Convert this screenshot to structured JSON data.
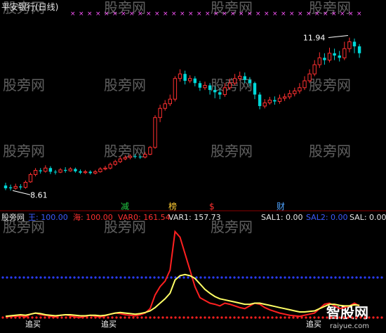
{
  "header": {
    "title": "平安银行(日线)"
  },
  "price_panel": {
    "high_label": "11.94",
    "low_label": "8.61",
    "markers": [
      {
        "text": "减",
        "color": "#22cc44"
      },
      {
        "text": "榜",
        "color": "#ffcc33"
      },
      {
        "text": "$",
        "color": "#ff3030"
      },
      {
        "text": "财",
        "color": "#4fa3ff"
      }
    ]
  },
  "indicator_panel": {
    "labels": [
      {
        "text": "王: 100.00",
        "color": "#3b5bff"
      },
      {
        "text": "海: 100.00",
        "color": "#ff3030"
      },
      {
        "text": "VAR0: 161.54",
        "color": "#ff3030"
      },
      {
        "text": "VAR1: 157.73",
        "color": "#e6e6e6"
      },
      {
        "text": "SAL1: 0.00",
        "color": "#e6e6e6"
      },
      {
        "text": "SAL2: 0.00",
        "color": "#3b5bff"
      },
      {
        "text": "SAL: 0.00",
        "color": "#e6e6e6"
      }
    ],
    "signals": [
      {
        "text": "追买"
      },
      {
        "text": "追买"
      },
      {
        "text": "追买"
      }
    ]
  },
  "watermarks": [
    "股旁网",
    "智股网",
    "raiyue.com"
  ],
  "colors": {
    "up": "#ff3030",
    "down": "#00d8d8",
    "flat": "#ffffff",
    "var0": "#ff2020",
    "var1": "#ffff66",
    "blue_dots": "#2a3dff",
    "red_dots": "#ff2020",
    "pink_marks": "#ff55ff",
    "separator": "#8b0000"
  },
  "chart_data": [
    {
      "type": "candlestick",
      "title": "平安银行(日线)",
      "annotations": [
        "11.94",
        "8.61"
      ],
      "candles": [
        [
          8.72,
          8.66,
          8.78,
          8.62
        ],
        [
          8.68,
          8.66,
          8.74,
          8.61
        ],
        [
          8.66,
          8.7,
          8.76,
          8.63
        ],
        [
          8.7,
          8.68,
          8.75,
          8.63
        ],
        [
          8.68,
          8.79,
          8.83,
          8.65
        ],
        [
          8.8,
          8.96,
          9.0,
          8.78
        ],
        [
          8.96,
          9.05,
          9.1,
          8.92
        ],
        [
          9.05,
          9.03,
          9.1,
          8.98
        ],
        [
          9.03,
          9.1,
          9.16,
          9.0
        ],
        [
          9.1,
          9.02,
          9.14,
          8.97
        ],
        [
          9.02,
          9.01,
          9.06,
          8.96
        ],
        [
          9.01,
          9.06,
          9.1,
          8.99
        ],
        [
          9.06,
          9.04,
          9.12,
          9.0
        ],
        [
          9.04,
          9.08,
          9.12,
          9.02
        ],
        [
          9.08,
          9.03,
          9.11,
          9.0
        ],
        [
          9.03,
          9.0,
          9.07,
          8.97
        ],
        [
          9.0,
          9.02,
          9.06,
          8.97
        ],
        [
          9.02,
          8.99,
          9.05,
          8.96
        ],
        [
          8.99,
          9.02,
          9.06,
          8.96
        ],
        [
          9.02,
          9.08,
          9.12,
          9.0
        ],
        [
          9.08,
          9.1,
          9.15,
          9.05
        ],
        [
          9.1,
          9.18,
          9.22,
          9.07
        ],
        [
          9.18,
          9.24,
          9.28,
          9.15
        ],
        [
          9.24,
          9.3,
          9.35,
          9.21
        ],
        [
          9.3,
          9.33,
          9.38,
          9.27
        ],
        [
          9.33,
          9.36,
          9.4,
          9.29
        ],
        [
          9.36,
          9.35,
          9.4,
          9.31
        ],
        [
          9.35,
          9.34,
          9.39,
          9.3
        ],
        [
          9.34,
          9.4,
          9.45,
          9.31
        ],
        [
          9.4,
          9.55,
          9.58,
          9.38
        ],
        [
          9.55,
          10.2,
          10.25,
          9.52
        ],
        [
          10.2,
          10.4,
          10.48,
          10.1
        ],
        [
          10.4,
          10.5,
          10.58,
          10.35
        ],
        [
          10.5,
          10.6,
          10.7,
          10.45
        ],
        [
          10.6,
          11.05,
          11.1,
          10.55
        ],
        [
          11.05,
          11.15,
          11.25,
          10.98
        ],
        [
          11.15,
          11.0,
          11.22,
          10.92
        ],
        [
          11.0,
          11.05,
          11.12,
          10.95
        ],
        [
          11.05,
          10.95,
          11.1,
          10.88
        ],
        [
          10.95,
          10.85,
          11.0,
          10.78
        ],
        [
          10.85,
          10.9,
          10.98,
          10.8
        ],
        [
          10.9,
          10.8,
          10.95,
          10.7
        ],
        [
          10.8,
          10.75,
          10.88,
          10.62
        ],
        [
          10.75,
          10.7,
          10.82,
          10.6
        ],
        [
          10.7,
          10.85,
          10.95,
          10.65
        ],
        [
          10.85,
          10.95,
          11.05,
          10.8
        ],
        [
          10.95,
          11.05,
          11.15,
          10.9
        ],
        [
          11.05,
          11.1,
          11.2,
          11.0
        ],
        [
          11.1,
          11.02,
          11.18,
          10.95
        ],
        [
          11.02,
          10.95,
          11.08,
          10.88
        ],
        [
          10.95,
          10.7,
          10.98,
          10.6
        ],
        [
          10.7,
          10.45,
          10.75,
          10.38
        ],
        [
          10.45,
          10.52,
          10.6,
          10.4
        ],
        [
          10.52,
          10.58,
          10.65,
          10.48
        ],
        [
          10.58,
          10.55,
          10.66,
          10.48
        ],
        [
          10.55,
          10.62,
          10.7,
          10.5
        ],
        [
          10.62,
          10.65,
          10.72,
          10.56
        ],
        [
          10.65,
          10.72,
          10.8,
          10.6
        ],
        [
          10.72,
          10.78,
          10.85,
          10.66
        ],
        [
          10.78,
          10.85,
          10.95,
          10.72
        ],
        [
          10.85,
          11.0,
          11.1,
          10.8
        ],
        [
          11.0,
          11.15,
          11.25,
          10.95
        ],
        [
          11.15,
          11.35,
          11.45,
          11.1
        ],
        [
          11.35,
          11.5,
          11.62,
          11.28
        ],
        [
          11.5,
          11.45,
          11.6,
          11.35
        ],
        [
          11.45,
          11.6,
          11.72,
          11.4
        ],
        [
          11.6,
          11.55,
          11.7,
          11.45
        ],
        [
          11.55,
          11.5,
          11.65,
          11.42
        ],
        [
          11.5,
          11.7,
          11.85,
          11.45
        ],
        [
          11.7,
          11.85,
          11.94,
          11.62
        ],
        [
          11.85,
          11.75,
          11.92,
          11.6
        ],
        [
          11.75,
          11.6,
          11.8,
          11.5
        ]
      ]
    },
    {
      "type": "line",
      "series": [
        {
          "name": "VAR0",
          "values": [
            5,
            6,
            6,
            7,
            5,
            10,
            12,
            9,
            8,
            6,
            5,
            8,
            9,
            7,
            5,
            4,
            6,
            8,
            6,
            5,
            7,
            10,
            12,
            11,
            9,
            8,
            7,
            9,
            12,
            20,
            45,
            60,
            70,
            90,
            160,
            150,
            120,
            90,
            60,
            40,
            35,
            30,
            28,
            25,
            30,
            28,
            25,
            22,
            20,
            25,
            30,
            28,
            22,
            18,
            15,
            12,
            10,
            8,
            7,
            6,
            8,
            10,
            12,
            20,
            28,
            30,
            25,
            20,
            22,
            25,
            30,
            25
          ]
        },
        {
          "name": "VAR1",
          "values": [
            6,
            7,
            8,
            9,
            8,
            10,
            12,
            11,
            9,
            8,
            7,
            8,
            9,
            9,
            8,
            7,
            7,
            8,
            8,
            7,
            8,
            10,
            12,
            13,
            12,
            11,
            10,
            11,
            13,
            16,
            22,
            30,
            38,
            48,
            72,
            80,
            82,
            80,
            75,
            65,
            55,
            48,
            42,
            38,
            36,
            34,
            32,
            30,
            28,
            28,
            30,
            30,
            28,
            26,
            24,
            22,
            20,
            18,
            16,
            14,
            14,
            15,
            16,
            20,
            24,
            28,
            28,
            26,
            25,
            25,
            27,
            26
          ]
        }
      ]
    }
  ]
}
